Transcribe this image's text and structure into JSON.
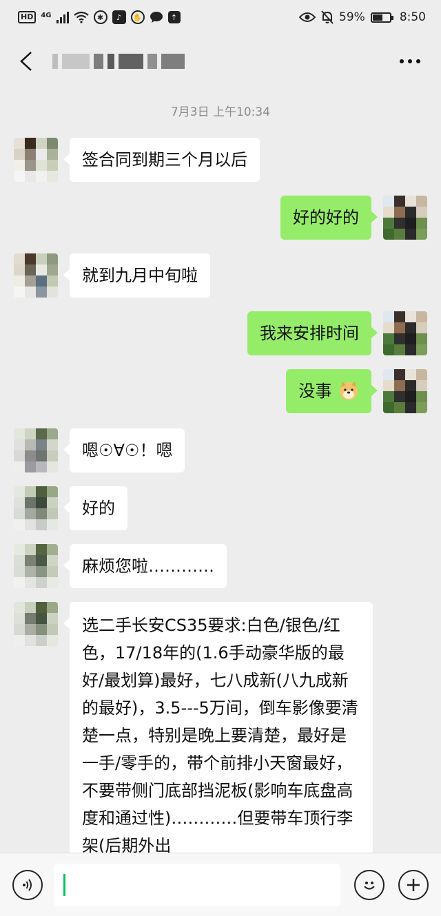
{
  "status_bar": {
    "hd": "HD",
    "network": "4G",
    "battery_percent": "59%",
    "battery_level": 0.59,
    "time": "8:50"
  },
  "title_bar": {
    "back_icon": "chevron-left-icon",
    "more_icon": "more-icon"
  },
  "chat": {
    "timestamp": "7月3日 上午10:34",
    "messages": [
      {
        "side": "in",
        "text": "签合同到期三个月以后"
      },
      {
        "side": "out",
        "text": "好的好的"
      },
      {
        "side": "in",
        "text": "就到九月中旬啦"
      },
      {
        "side": "out",
        "text": "我来安排时间"
      },
      {
        "side": "out",
        "text": "没事",
        "emoji": "doge-emoji"
      },
      {
        "side": "in",
        "text": "嗯☉∀☉！嗯"
      },
      {
        "side": "in",
        "text": "好的"
      },
      {
        "side": "in",
        "text": "麻烦您啦…………"
      },
      {
        "side": "in",
        "text": "选二手长安CS35要求:白色/银色/红色，17/18年的(1.6手动豪华版的最好/最划算)最好，七八成新(八九成新的最好)，3.5---5万间，倒车影像要清楚一点，特别是晚上要清楚，最好是一手/零手的，带个前排小天窗最好，不要带侧门底部挡泥板(影响车底盘高度和通过性)…………但要带车顶行李架(后期外出"
      }
    ]
  },
  "input_bar": {
    "voice_icon": "voice-icon",
    "emoji_icon": "emoji-icon",
    "plus_icon": "plus-icon",
    "accent_color": "#07c160"
  },
  "colors": {
    "background": "#ededed",
    "outgoing_bubble": "#95ec69",
    "incoming_bubble": "#ffffff"
  }
}
